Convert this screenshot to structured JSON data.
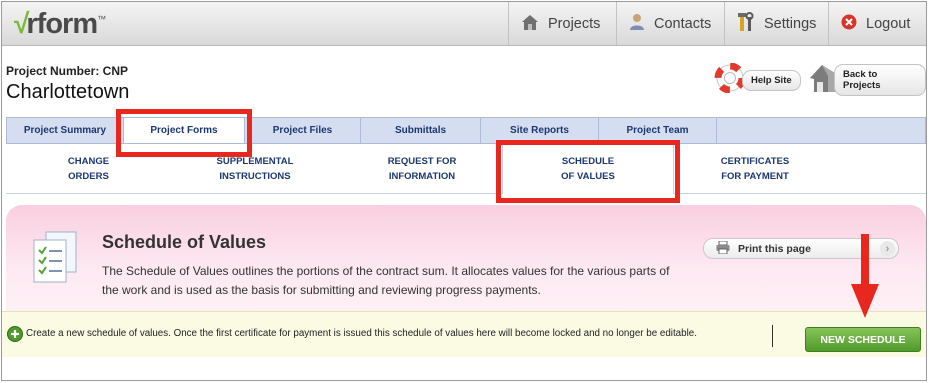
{
  "app": {
    "logo_check": "√",
    "logo_text": "rform",
    "logo_tm": "™"
  },
  "topnav": {
    "items": [
      {
        "label": "Projects",
        "icon": "projects-house-icon"
      },
      {
        "label": "Contacts",
        "icon": "contacts-person-icon"
      },
      {
        "label": "Settings",
        "icon": "settings-tools-icon"
      },
      {
        "label": "Logout",
        "icon": "logout-x-icon"
      }
    ]
  },
  "project": {
    "number_label": "Project Number: CNP",
    "name": "Charlottetown"
  },
  "actions": {
    "help_label": "Help Site",
    "back_label": "Back to Projects"
  },
  "tabs": [
    {
      "label": "Project Summary"
    },
    {
      "label": "Project Forms",
      "active": true
    },
    {
      "label": "Project Files"
    },
    {
      "label": "Submittals"
    },
    {
      "label": "Site Reports"
    },
    {
      "label": "Project Team"
    }
  ],
  "subtabs": [
    {
      "line1": "CHANGE",
      "line2": "ORDERS"
    },
    {
      "line1": "SUPPLEMENTAL",
      "line2": "INSTRUCTIONS"
    },
    {
      "line1": "REQUEST FOR",
      "line2": "INFORMATION"
    },
    {
      "line1": "SCHEDULE",
      "line2": "OF VALUES",
      "active": true
    },
    {
      "line1": "CERTIFICATES",
      "line2": "FOR PAYMENT"
    }
  ],
  "panel": {
    "title": "Schedule of Values",
    "description": "The Schedule of Values outlines the portions of the contract sum. It allocates values for the various parts of the work and is used as the basis for submitting and reviewing progress payments.",
    "print_label": "Print this page",
    "print_chevron": "›"
  },
  "newbar": {
    "text": "Create a new schedule of values. Once the first certificate for payment is issued this schedule of values here will become locked and no longer be editable.",
    "button_label": "NEW SCHEDULE"
  },
  "colors": {
    "highlight": "#e8281e",
    "tab_text": "#1b3770",
    "button_green": "#4f9a2a"
  }
}
